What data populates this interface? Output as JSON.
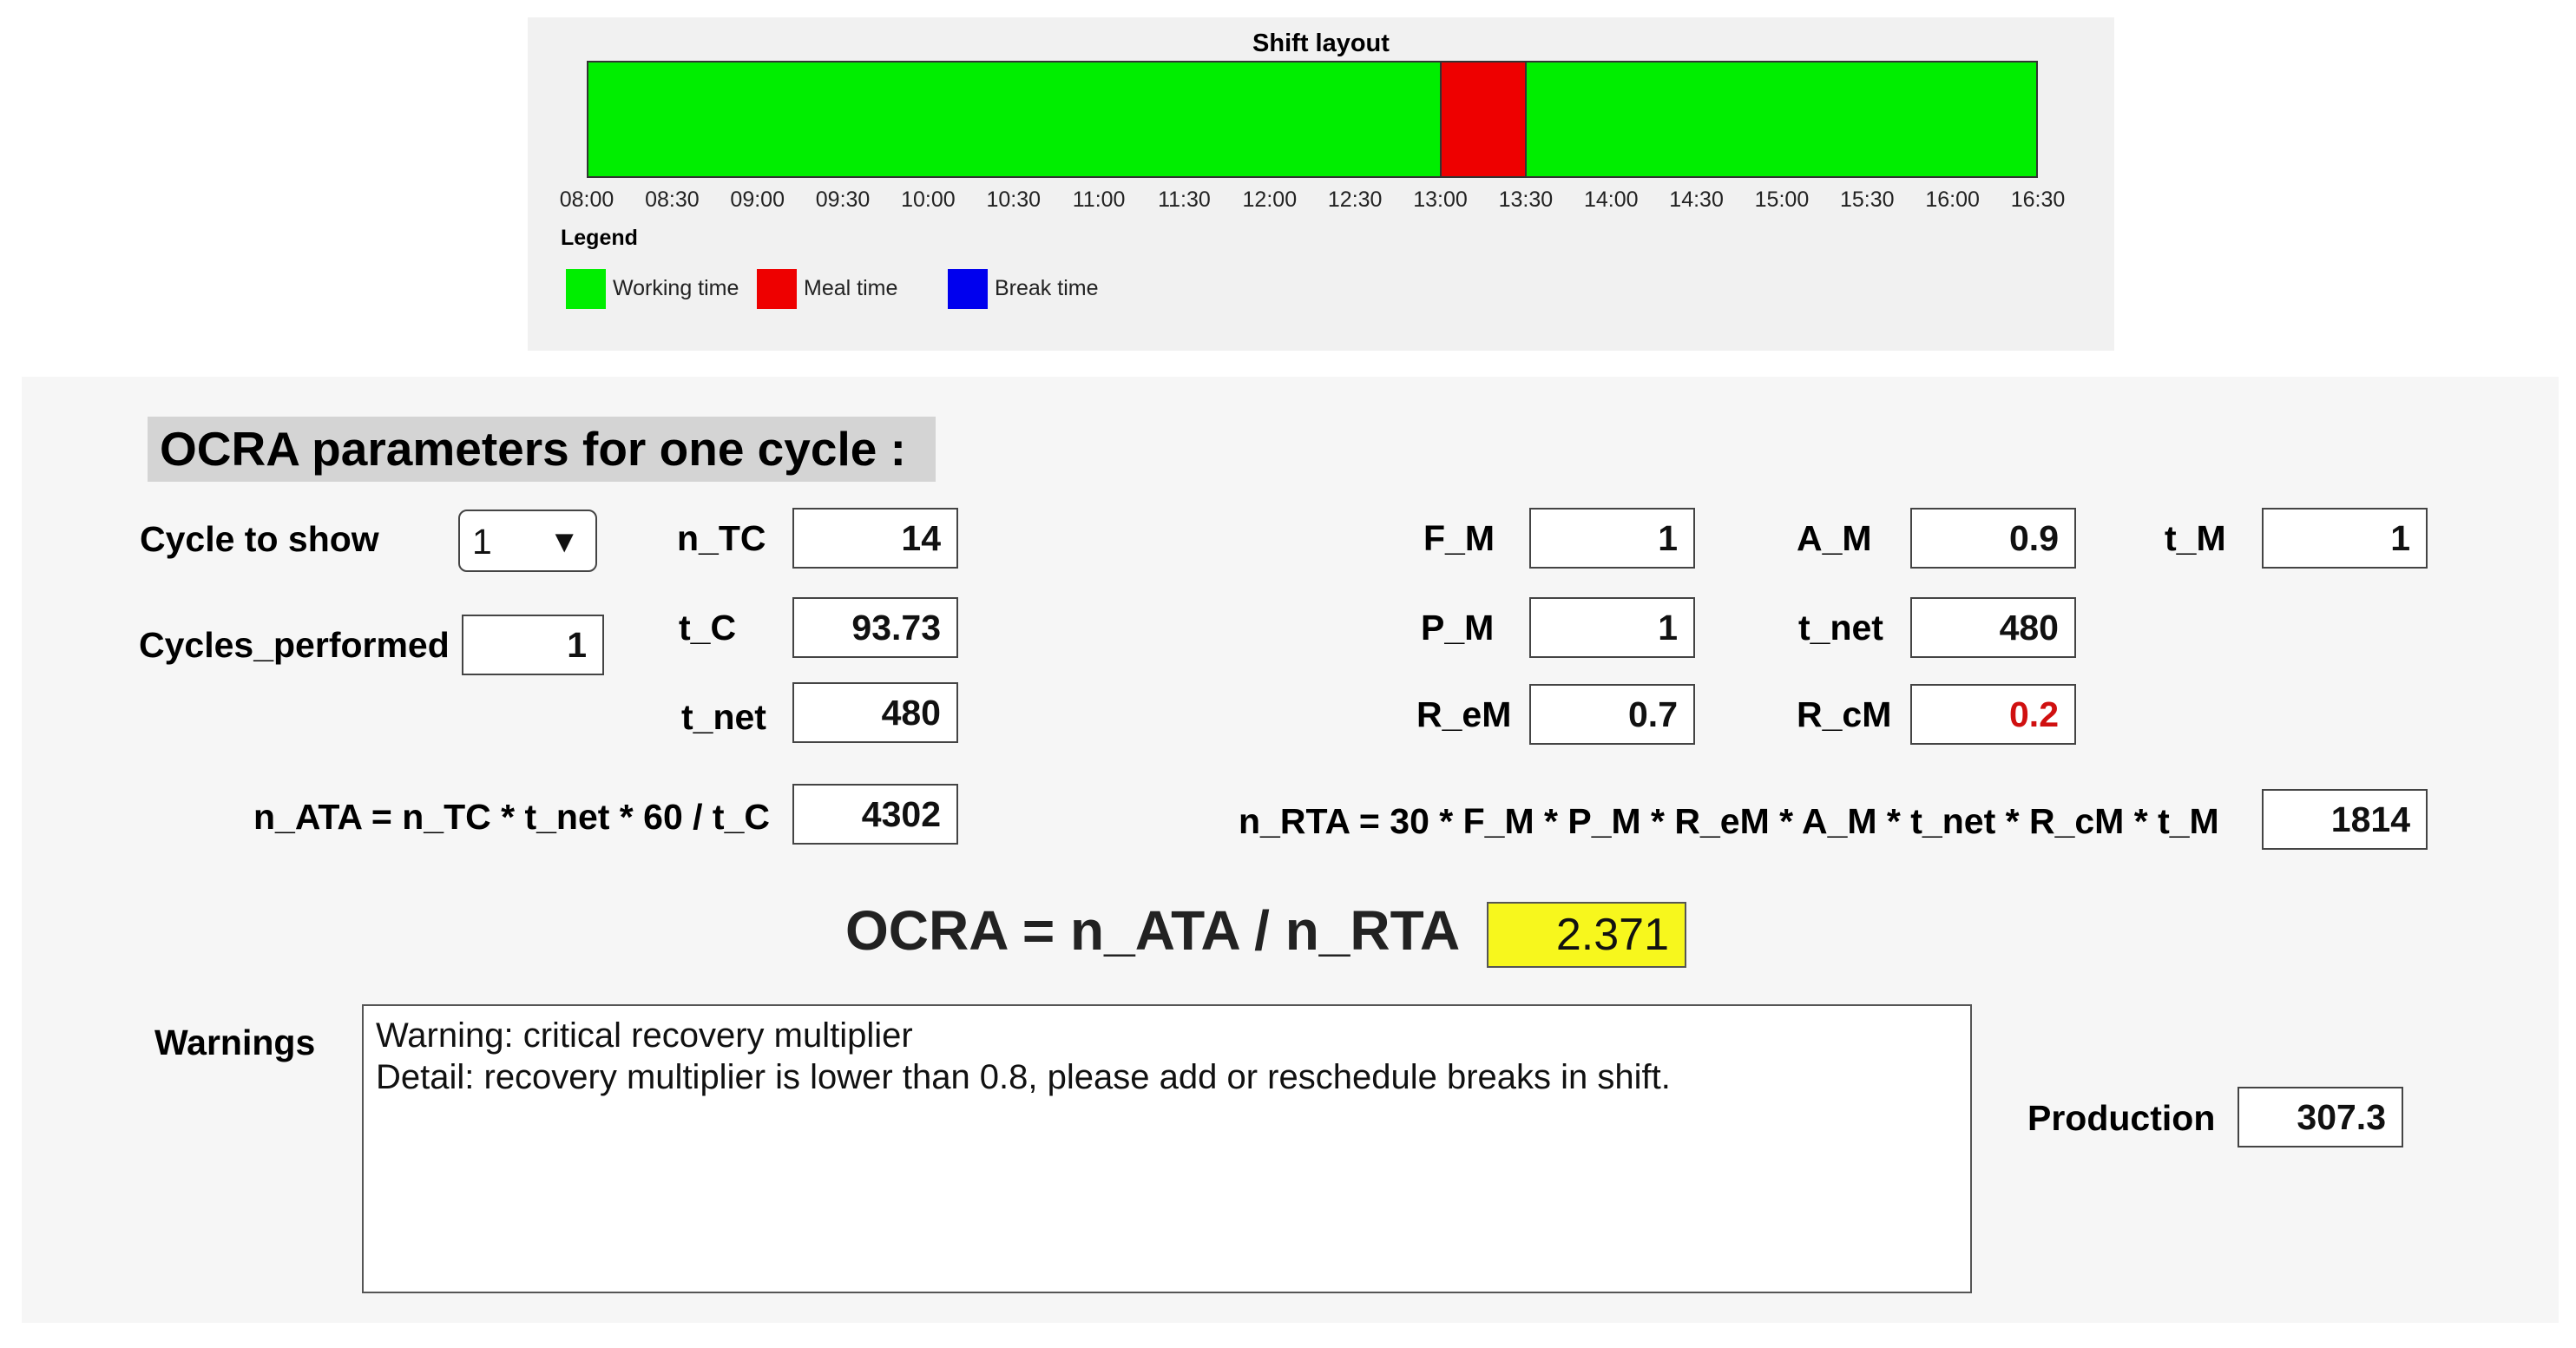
{
  "shift_layout": {
    "title": "Shift layout",
    "ticks": [
      "08:00",
      "08:30",
      "09:00",
      "09:30",
      "10:00",
      "10:30",
      "11:00",
      "11:30",
      "12:00",
      "12:30",
      "13:00",
      "13:30",
      "14:00",
      "14:30",
      "15:00",
      "15:30",
      "16:00",
      "16:30"
    ],
    "start": "08:00",
    "end": "16:30",
    "segments": [
      {
        "type": "working",
        "from": "08:00",
        "to": "13:00"
      },
      {
        "type": "meal",
        "from": "13:00",
        "to": "13:30"
      },
      {
        "type": "working",
        "from": "13:30",
        "to": "16:30"
      }
    ],
    "legend_title": "Legend",
    "legend": [
      {
        "label": "Working time",
        "color": "#00ee00"
      },
      {
        "label": "Meal time",
        "color": "#ee0000"
      },
      {
        "label": "Break time",
        "color": "#0000ee"
      }
    ]
  },
  "params": {
    "title": "OCRA parameters for one cycle :",
    "cycle_to_show_label": "Cycle to show",
    "cycle_to_show_value": "1",
    "cycles_performed_label": "Cycles_performed",
    "cycles_performed_value": "1",
    "n_TC_label": "n_TC",
    "n_TC": "14",
    "t_C_label": "t_C",
    "t_C": "93.73",
    "t_net_label": "t_net",
    "t_net": "480",
    "n_ATA_formula": "n_ATA = n_TC * t_net * 60 / t_C",
    "n_ATA": "4302",
    "F_M_label": "F_M",
    "F_M": "1",
    "A_M_label": "A_M",
    "A_M": "0.9",
    "t_M_label": "t_M",
    "t_M": "1",
    "P_M_label": "P_M",
    "P_M": "1",
    "t_net2_label": "t_net",
    "t_net2": "480",
    "R_eM_label": "R_eM",
    "R_eM": "0.7",
    "R_cM_label": "R_cM",
    "R_cM": "0.2",
    "n_RTA_formula": "n_RTA = 30 * F_M * P_M * R_eM * A_M * t_net * R_cM * t_M",
    "n_RTA": "1814",
    "ocra_formula": "OCRA = n_ATA / n_RTA",
    "ocra": "2.371",
    "warnings_label": "Warnings",
    "warnings": [
      "Warning:  critical recovery multiplier",
      "Detail:  recovery multiplier is lower than 0.8, please add or reschedule breaks in shift."
    ],
    "production_label": "Production",
    "production": "307.3"
  },
  "colors": {
    "working": "#00ee00",
    "meal": "#ee0000",
    "break": "#0000ee",
    "ocra_highlight": "#f7f71d",
    "critical_value": "#d01010"
  }
}
